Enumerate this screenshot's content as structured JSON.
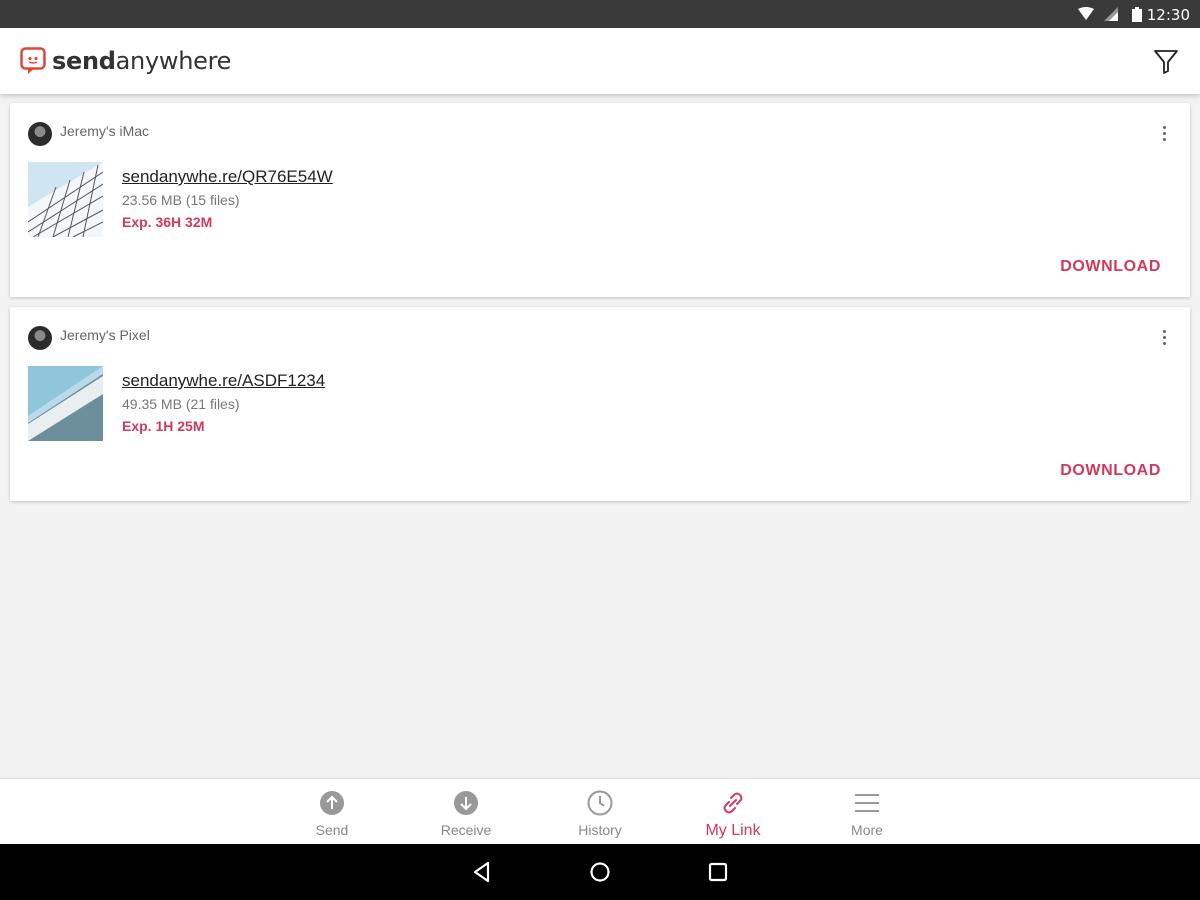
{
  "status_bar": {
    "time": "12:30"
  },
  "header": {
    "logo_text_bold": "send",
    "logo_text_rest": "anywhere",
    "filter_icon": "filter-icon"
  },
  "transfers": [
    {
      "device": "Jeremy's iMac",
      "link": "sendanywhe.re/QR76E54W",
      "size": "23.56 MB (15 files)",
      "expiry": "Exp. 36H 32M",
      "action": "DOWNLOAD"
    },
    {
      "device": "Jeremy's Pixel",
      "link": "sendanywhe.re/ASDF1234",
      "size": "49.35 MB (21 files)",
      "expiry": "Exp. 1H 25M",
      "action": "DOWNLOAD"
    }
  ],
  "bottom_nav": {
    "items": [
      {
        "label": "Send",
        "icon": "upload-icon"
      },
      {
        "label": "Receive",
        "icon": "download-icon"
      },
      {
        "label": "History",
        "icon": "clock-icon"
      },
      {
        "label": "My Link",
        "icon": "link-icon",
        "active": true
      },
      {
        "label": "More",
        "icon": "menu-icon"
      }
    ]
  },
  "colors": {
    "accent": "#d03a5c",
    "status_bar": "#3a3a3a",
    "background": "#f2f2f2"
  }
}
